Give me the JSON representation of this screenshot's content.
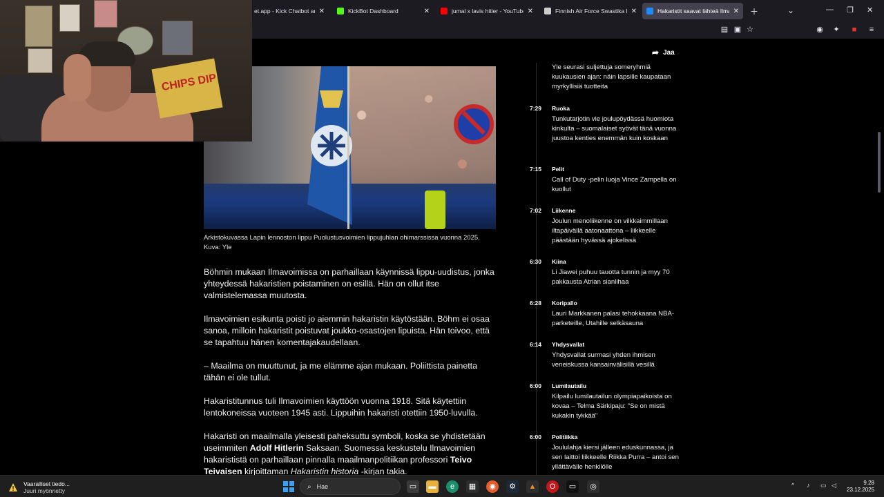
{
  "browser": {
    "tabs": [
      {
        "title": "et.app - Kick Chatbot and",
        "favicon_color": "#53fc18",
        "active": false
      },
      {
        "title": "KickBot Dashboard",
        "favicon_color": "#53fc18",
        "active": false
      },
      {
        "title": "jumal x lavis hitler - YouTube",
        "favicon_color": "#ff0000",
        "active": false
      },
      {
        "title": "Finnish Air Force Swastika Histo",
        "favicon_color": "#cccccc",
        "active": false
      },
      {
        "title": "Hakaristit saavat lähteä Ilmavoi",
        "favicon_color": "#1a8cff",
        "active": true
      }
    ],
    "new_tab_icon": "plus-icon",
    "list_tabs_icon": "chevron-down-icon"
  },
  "article": {
    "share_label": "Jaa",
    "caption": "Arkistokuvassa Lapin lennoston lippu Puolustusvoimien lippujuhlan ohimarssissa vuonna 2025. Kuva: Yle",
    "paragraphs": {
      "p1": "Böhmin mukaan Ilmavoimissa on parhaillaan käynnissä lippu-uudistus, jonka yhteydessä hakaristien poistaminen on esillä. Hän on ollut itse valmistelemassa muutosta.",
      "p2": "Ilmavoimien esikunta poisti jo aiemmin hakaristin käytöstään. Böhm ei osaa sanoa, milloin hakaristit poistuvat joukko-osastojen lipuista. Hän toivoo, että se tapahtuu hänen komentajakaudellaan.",
      "p3": "– Maailma on muuttunut, ja me elämme ajan mukaan. Poliittista painetta tähän ei ole tullut.",
      "p4": "Hakaristitunnus tuli Ilmavoimien käyttöön vuonna 1918. Sitä käytettiin lentokoneissa vuoteen 1945 asti. Lippuihin hakaristi otettiin 1950-luvulla.",
      "p5a": "Hakaristi on maailmalla yleisesti paheksuttu symboli, koska se yhdistetään useimmiten ",
      "p5b": "Adolf Hitlerin",
      "p5c": " Saksaan. Suomessa keskustelu Ilmavoimien hakarististä on parhaillaan pinnalla maailmanpolitiikan professori ",
      "p5d": "Teivo Teivaisen",
      "p5e": " kirjoittaman ",
      "p5f": "Hakaristin historia",
      "p5g": " -kirjan takia."
    }
  },
  "feed": {
    "top_item": "Yle seurasi suljettuja someryhmiä kuukausien ajan: näin lapsille kaupataan myrkyllisiä tuotteita",
    "items": [
      {
        "time": "7:29",
        "category": "Ruoka",
        "title": "Tunkutarjotin vie joulupöydässä huomiota kinkulta – suomalaiset syövät tänä vuonna juustoa kenties enemmän kuin koskaan"
      },
      {
        "time": "7:15",
        "category": "Pelit",
        "title": "Call of Duty -pelin luoja Vince Zampella on kuollut"
      },
      {
        "time": "7:02",
        "category": "Liikenne",
        "title": "Joulun menoliikenne on vilkkaimmillaan iltapäivällä aatonaattona – liikkeelle päästään hyvässä ajokelissä"
      },
      {
        "time": "6:30",
        "category": "Kiina",
        "title": "Li Jiawei puhuu tauotta tunnin ja myy 70 pakkausta Atrian sianlihaa"
      },
      {
        "time": "6:28",
        "category": "Koripallo",
        "title": "Lauri Markkanen palasi tehokkaana NBA-parketeille, Utahille selkäsauna"
      },
      {
        "time": "6:14",
        "category": "Yhdysvallat",
        "title": "Yhdysvallat surmasi yhden ihmisen veneiskussa kansainvälisillä vesillä"
      },
      {
        "time": "6:00",
        "category": "Lumilautailu",
        "title": "Kilpailu lumilautailun olympiapaikoista on kovaa – Telma Särkipaju: \"Se on mistä kukakin tykkää\""
      },
      {
        "time": "6:00",
        "category": "Politiikka",
        "title": "Joululahja kiersi jälleen eduskunnassa, ja sen laittoi liikkeelle Riikka Purra – antoi sen yllättävälle henkilölle"
      }
    ]
  },
  "webcam": {
    "sign_text": "CHIPS DIP"
  },
  "taskbar": {
    "notification_title": "Vaaralliset tiedo...",
    "notification_status": "Juuri myönnetty",
    "search_placeholder": "Hae",
    "time": "9.28",
    "date": "23.12.2025"
  }
}
